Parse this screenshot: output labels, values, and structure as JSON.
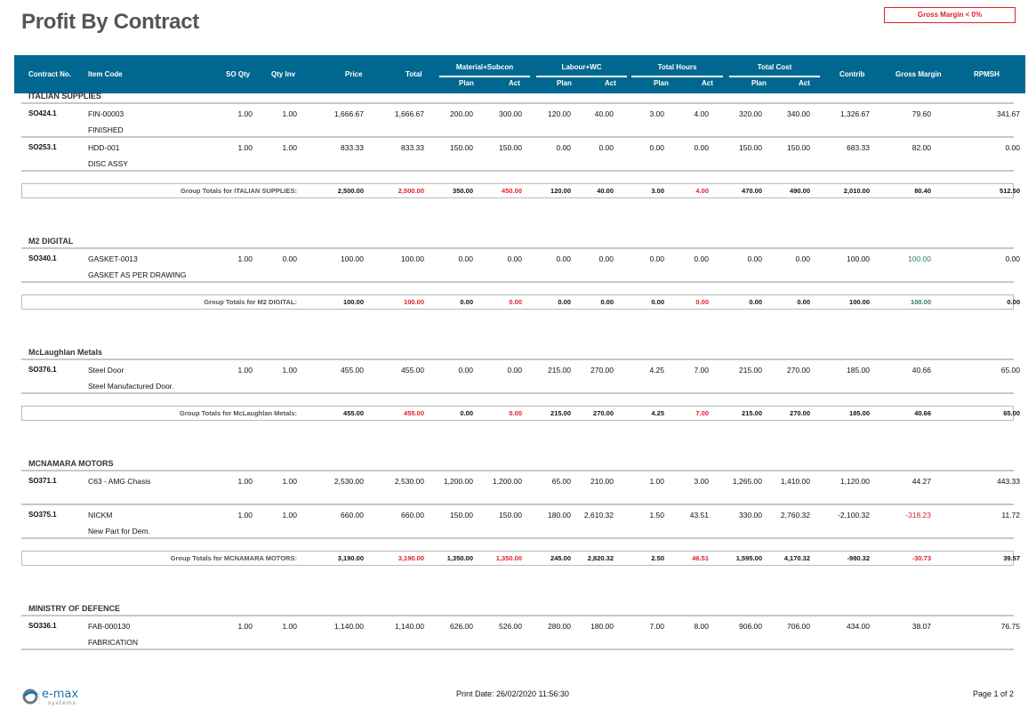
{
  "title": "Profit By Contract",
  "legend": "Gross Margin < 0%",
  "colors": {
    "header_bg": "#006890",
    "negative": "#e0202a",
    "highlight_total": "#e0202a",
    "gm_full": "#2e7d5b"
  },
  "header": {
    "contract": "Contract No.",
    "item": "Item Code",
    "so_qty": "SO Qty",
    "qty_inv": "Qty Inv",
    "price": "Price",
    "total": "Total",
    "material": "Material+Subcon",
    "labour": "Labour+WC",
    "hours": "Total Hours",
    "cost": "Total Cost",
    "plan": "Plan",
    "act": "Act",
    "contrib": "Contrib",
    "gross_margin": "Gross Margin",
    "rpmsh": "RPMSH"
  },
  "groups": [
    {
      "name": "ITALIAN SUPPLIES",
      "rows": [
        {
          "contract": "SO424.1",
          "item": "FIN-00003",
          "desc": "FINISHED",
          "values": [
            "1.00",
            "1.00",
            "1,666.67",
            "1,666.67",
            "200.00",
            "300.00",
            "120.00",
            "40.00",
            "3.00",
            "4.00",
            "320.00",
            "340.00",
            "1,326.67",
            "79.60",
            "341.67"
          ]
        },
        {
          "contract": "SO253.1",
          "item": "HDD-001",
          "desc": "DISC ASSY",
          "values": [
            "1.00",
            "1.00",
            "833.33",
            "833.33",
            "150.00",
            "150.00",
            "0.00",
            "0.00",
            "0.00",
            "0.00",
            "150.00",
            "150.00",
            "683.33",
            "82.00",
            "0.00"
          ]
        }
      ],
      "totals": {
        "label": "Group Totals for ITALIAN SUPPLIES:",
        "values": [
          "2,500.00",
          "2,500.00",
          "350.00",
          "450.00",
          "120.00",
          "40.00",
          "3.00",
          "4.00",
          "470.00",
          "490.00",
          "2,010.00",
          "80.40",
          "512.50"
        ]
      }
    },
    {
      "name": "M2 DIGITAL",
      "rows": [
        {
          "contract": "SO340.1",
          "item": "GASKET-0013",
          "desc": "GASKET AS PER DRAWING",
          "values": [
            "1.00",
            "0.00",
            "100.00",
            "100.00",
            "0.00",
            "0.00",
            "0.00",
            "0.00",
            "0.00",
            "0.00",
            "0.00",
            "0.00",
            "100.00",
            "100.00",
            "0.00"
          ]
        }
      ],
      "totals": {
        "label": "Group Totals for M2 DIGITAL:",
        "values": [
          "100.00",
          "100.00",
          "0.00",
          "0.00",
          "0.00",
          "0.00",
          "0.00",
          "0.00",
          "0.00",
          "0.00",
          "100.00",
          "100.00",
          "0.00"
        ]
      }
    },
    {
      "name": "McLaughlan Metals",
      "rows": [
        {
          "contract": "SO376.1",
          "item": "Steel Door",
          "desc": "Steel Manufactured Door.",
          "values": [
            "1.00",
            "1.00",
            "455.00",
            "455.00",
            "0.00",
            "0.00",
            "215.00",
            "270.00",
            "4.25",
            "7.00",
            "215.00",
            "270.00",
            "185.00",
            "40.66",
            "65.00"
          ]
        }
      ],
      "totals": {
        "label": "Group Totals for McLaughlan Metals:",
        "values": [
          "455.00",
          "455.00",
          "0.00",
          "0.00",
          "215.00",
          "270.00",
          "4.25",
          "7.00",
          "215.00",
          "270.00",
          "185.00",
          "40.66",
          "65.00"
        ]
      }
    },
    {
      "name": "MCNAMARA MOTORS",
      "rows": [
        {
          "contract": "SO371.1",
          "item": "C63 - AMG Chasis",
          "desc": "",
          "values": [
            "1.00",
            "1.00",
            "2,530.00",
            "2,530.00",
            "1,200.00",
            "1,200.00",
            "65.00",
            "210.00",
            "1.00",
            "3.00",
            "1,265.00",
            "1,410.00",
            "1,120.00",
            "44.27",
            "443.33"
          ]
        },
        {
          "contract": "SO375.1",
          "item": "NICKM",
          "desc": "New Part for Dem.",
          "values": [
            "1.00",
            "1.00",
            "660.00",
            "660.00",
            "150.00",
            "150.00",
            "180.00",
            "2,610.32",
            "1.50",
            "43.51",
            "330.00",
            "2,760.32",
            "-2,100.32",
            "-318.23",
            "11.72"
          ]
        }
      ],
      "totals": {
        "label": "Group Totals for MCNAMARA MOTORS:",
        "values": [
          "3,190.00",
          "3,190.00",
          "1,350.00",
          "1,350.00",
          "245.00",
          "2,820.32",
          "2.50",
          "46.51",
          "1,595.00",
          "4,170.32",
          "-980.32",
          "-30.73",
          "39.57"
        ]
      }
    },
    {
      "name": "MINISTRY OF DEFENCE",
      "rows": [
        {
          "contract": "SO336.1",
          "item": "FAB-000130",
          "desc": "FABRICATION",
          "values": [
            "1.00",
            "1.00",
            "1,140.00",
            "1,140.00",
            "626.00",
            "526.00",
            "280.00",
            "180.00",
            "7.00",
            "8.00",
            "906.00",
            "706.00",
            "434.00",
            "38.07",
            "76.75"
          ]
        }
      ]
    }
  ],
  "footer": {
    "logo_text": "e-max",
    "logo_sub": "systems",
    "print_date": "Print Date: 26/02/2020 11:56:30",
    "page": "Page 1 of 2"
  }
}
